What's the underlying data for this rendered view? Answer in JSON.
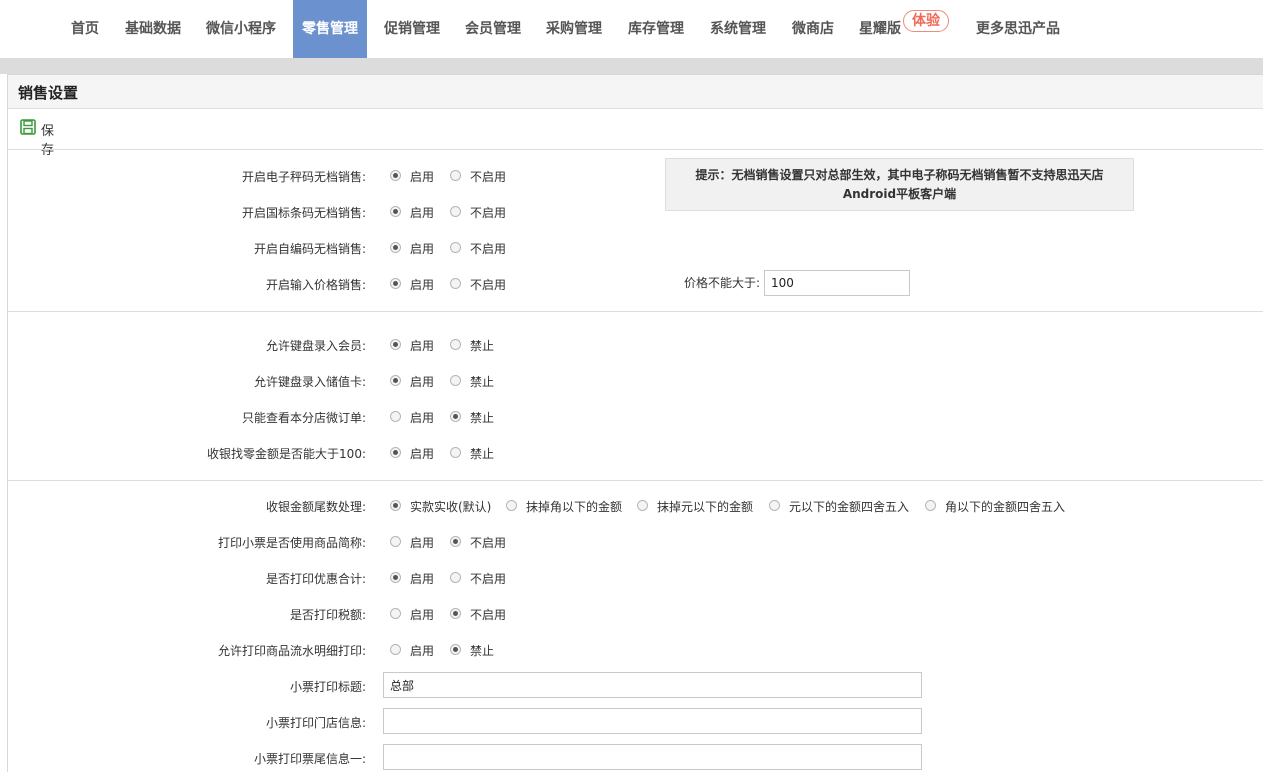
{
  "nav": {
    "items": [
      "首页",
      "基础数据",
      "微信小程序",
      "零售管理",
      "促销管理",
      "会员管理",
      "采购管理",
      "库存管理",
      "系统管理",
      "微商店",
      "星耀版",
      "更多思迅产品"
    ],
    "badge": "体验",
    "active_index": 3
  },
  "panel": {
    "title": "销售设置",
    "save_label": "保存"
  },
  "tip": {
    "line1": "提示：无档销售设置只对总部生效，其中电子称码无档销售暂不支持思迅天店",
    "line2": "Android平板客户端"
  },
  "price_limit": {
    "label": "价格不能大于:",
    "value": "100"
  },
  "section1": [
    {
      "label": "开启电子秤码无档销售:",
      "opt1": "启用",
      "opt2": "不启用",
      "selected": 1
    },
    {
      "label": "开启国标条码无档销售:",
      "opt1": "启用",
      "opt2": "不启用",
      "selected": 1
    },
    {
      "label": "开启自编码无档销售:",
      "opt1": "启用",
      "opt2": "不启用",
      "selected": 1
    },
    {
      "label": "开启输入价格销售:",
      "opt1": "启用",
      "opt2": "不启用",
      "selected": 1
    }
  ],
  "section2": [
    {
      "label": "允许键盘录入会员:",
      "opt1": "启用",
      "opt2": "禁止",
      "selected": 1
    },
    {
      "label": "允许键盘录入储值卡:",
      "opt1": "启用",
      "opt2": "禁止",
      "selected": 1
    },
    {
      "label": "只能查看本分店微订单:",
      "opt1": "启用",
      "opt2": "禁止",
      "selected": 2
    },
    {
      "label": "收银找零金额是否能大于100:",
      "opt1": "启用",
      "opt2": "禁止",
      "selected": 1
    }
  ],
  "rounding": {
    "label": "收银金额尾数处理:",
    "options": [
      "实款实收(默认)",
      "抹掉角以下的金额",
      "抹掉元以下的金额",
      "元以下的金额四舍五入",
      "角以下的金额四舍五入"
    ],
    "selected": 0
  },
  "section3": [
    {
      "label": "打印小票是否使用商品简称:",
      "opt1": "启用",
      "opt2": "不启用",
      "selected": 2
    },
    {
      "label": "是否打印优惠合计:",
      "opt1": "启用",
      "opt2": "不启用",
      "selected": 1
    },
    {
      "label": "是否打印税额:",
      "opt1": "启用",
      "opt2": "不启用",
      "selected": 2
    },
    {
      "label": "允许打印商品流水明细打印:",
      "opt1": "启用",
      "opt2": "禁止",
      "selected": 2
    }
  ],
  "receipt": {
    "title_label": "小票打印标题:",
    "title_value": "总部",
    "store_label": "小票打印门店信息:",
    "store_value": "",
    "footer_label": "小票打印票尾信息一:",
    "footer_value": ""
  }
}
